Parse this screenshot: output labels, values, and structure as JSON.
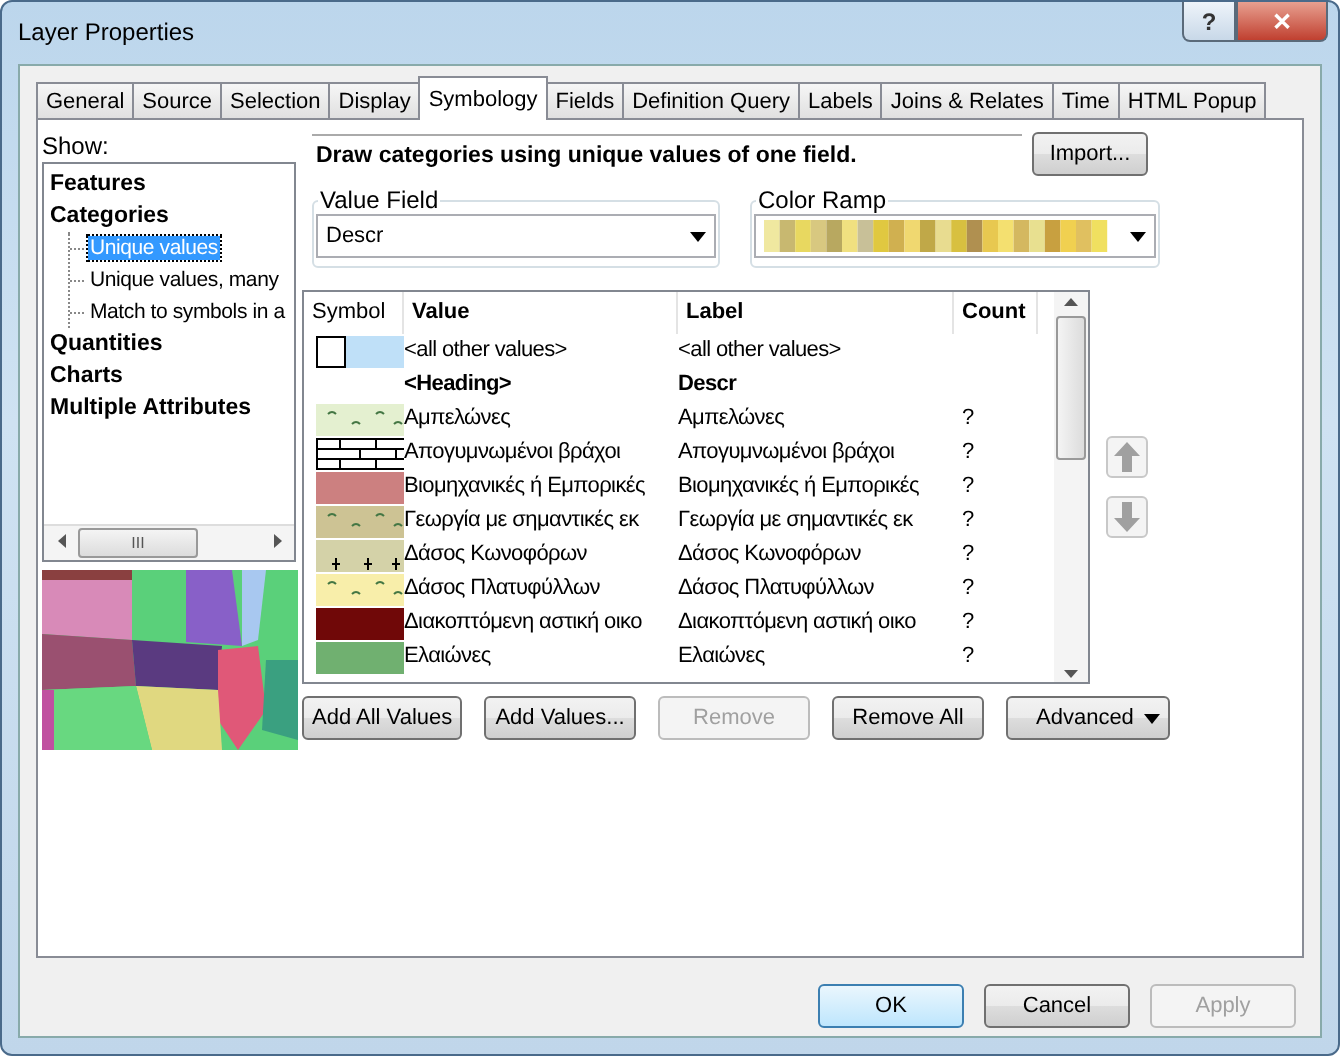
{
  "window": {
    "title": "Layer Properties",
    "help": "?",
    "close": "✕"
  },
  "tabs": [
    {
      "label": "General",
      "selected": false
    },
    {
      "label": "Source",
      "selected": false
    },
    {
      "label": "Selection",
      "selected": false
    },
    {
      "label": "Display",
      "selected": false
    },
    {
      "label": "Symbology",
      "selected": true
    },
    {
      "label": "Fields",
      "selected": false
    },
    {
      "label": "Definition Query",
      "selected": false
    },
    {
      "label": "Labels",
      "selected": false
    },
    {
      "label": "Joins & Relates",
      "selected": false
    },
    {
      "label": "Time",
      "selected": false
    },
    {
      "label": "HTML Popup",
      "selected": false
    }
  ],
  "show": {
    "label": "Show:",
    "items": [
      {
        "label": "Features",
        "selected": false
      },
      {
        "label": "Categories",
        "selected": false,
        "children": [
          {
            "label": "Unique values",
            "selected": true
          },
          {
            "label": "Unique values, many",
            "selected": false
          },
          {
            "label": "Match to symbols in a",
            "selected": false
          }
        ]
      },
      {
        "label": "Quantities",
        "selected": false
      },
      {
        "label": "Charts",
        "selected": false
      },
      {
        "label": "Multiple Attributes",
        "selected": false
      }
    ],
    "scroll_grip": "III"
  },
  "description": "Draw categories using unique values of one field.",
  "import_button": "Import...",
  "value_field": {
    "label": "Value Field",
    "value": "Descr"
  },
  "color_ramp": {
    "label": "Color Ramp"
  },
  "table": {
    "columns": [
      "Symbol",
      "Value",
      "Label",
      "Count"
    ],
    "rows": [
      {
        "kind": "other",
        "symbol": {
          "kind": "default",
          "color": "#bfe0f8"
        },
        "value": "<all other values>",
        "label": "<all other values>"
      },
      {
        "kind": "heading",
        "value": "<Heading>",
        "label": "Descr"
      },
      {
        "kind": "value",
        "symbol": {
          "kind": "dots",
          "color": "#e4f0d0"
        },
        "value": "Αμπελώνες",
        "label": "Αμπελώνες",
        "count": "?"
      },
      {
        "kind": "value",
        "symbol": {
          "kind": "bricks"
        },
        "value": "Απογυμνωμένοι βράχοι",
        "label": "Απογυμνωμένοι βράχοι",
        "count": "?"
      },
      {
        "kind": "value",
        "symbol": {
          "kind": "solid",
          "color": "#cc8080"
        },
        "value": "Βιομηχανικές ή Εμπορικές",
        "label": "Βιομηχανικές ή Εμπορικές",
        "count": "?"
      },
      {
        "kind": "value",
        "symbol": {
          "kind": "dots",
          "color": "#cdc394"
        },
        "value": "Γεωργία με σημαντικές εκ",
        "label": "Γεωργία με σημαντικές εκ",
        "count": "?"
      },
      {
        "kind": "value",
        "symbol": {
          "kind": "trees",
          "color": "#d4d2a8"
        },
        "value": "Δάσος Κωνοφόρων",
        "label": "Δάσος Κωνοφόρων",
        "count": "?"
      },
      {
        "kind": "value",
        "symbol": {
          "kind": "dots",
          "color": "#f8eeaa"
        },
        "value": "Δάσος Πλατυφύλλων",
        "label": "Δάσος Πλατυφύλλων",
        "count": "?"
      },
      {
        "kind": "value",
        "symbol": {
          "kind": "solid",
          "color": "#700808"
        },
        "value": "Διακοπτόμενη αστική  οικο",
        "label": "Διακοπτόμενη αστική  οικο",
        "count": "?"
      },
      {
        "kind": "value",
        "symbol": {
          "kind": "solid",
          "color": "#70b070"
        },
        "value": "Ελαιώνες",
        "label": "Ελαιώνες",
        "count": "?"
      }
    ]
  },
  "actions": [
    {
      "label": "Add All Values",
      "disabled": false
    },
    {
      "label": "Add Values...",
      "disabled": false
    },
    {
      "label": "Remove",
      "disabled": true
    },
    {
      "label": "Remove All",
      "disabled": false
    }
  ],
  "advanced": "Advanced",
  "footer": [
    {
      "label": "OK",
      "disabled": false,
      "default": true
    },
    {
      "label": "Cancel",
      "disabled": false,
      "default": false
    },
    {
      "label": "Apply",
      "disabled": true,
      "default": false
    }
  ]
}
